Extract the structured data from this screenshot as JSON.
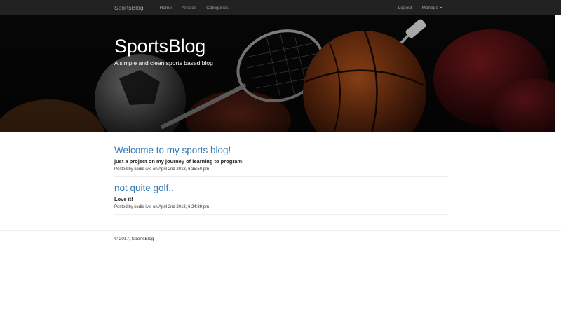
{
  "navbar": {
    "brand": "SportsBlog",
    "links": [
      {
        "label": "Home"
      },
      {
        "label": "Articles"
      },
      {
        "label": "Categories"
      }
    ],
    "right": {
      "logout": "Logout",
      "manage": "Manage"
    }
  },
  "hero": {
    "title": "SportsBlog",
    "subtitle": "A simple and clean sports based blog"
  },
  "posts": [
    {
      "title": "Welcome to my sports blog!",
      "excerpt": "just a project on my journey of learning to program!",
      "meta": "Posted by kodie ivie on April 2nd 2018, 6:35:50 pm"
    },
    {
      "title": "not quite golf..",
      "excerpt": "Love it!",
      "meta": "Posted by kodie ivie on April 2nd 2018, 6:24:39 pm"
    }
  ],
  "footer": {
    "text": "© 2017, SportsBlog"
  },
  "colors": {
    "navbar_bg": "#222222",
    "nav_text": "#9d9d9d",
    "link": "#337ab7"
  }
}
